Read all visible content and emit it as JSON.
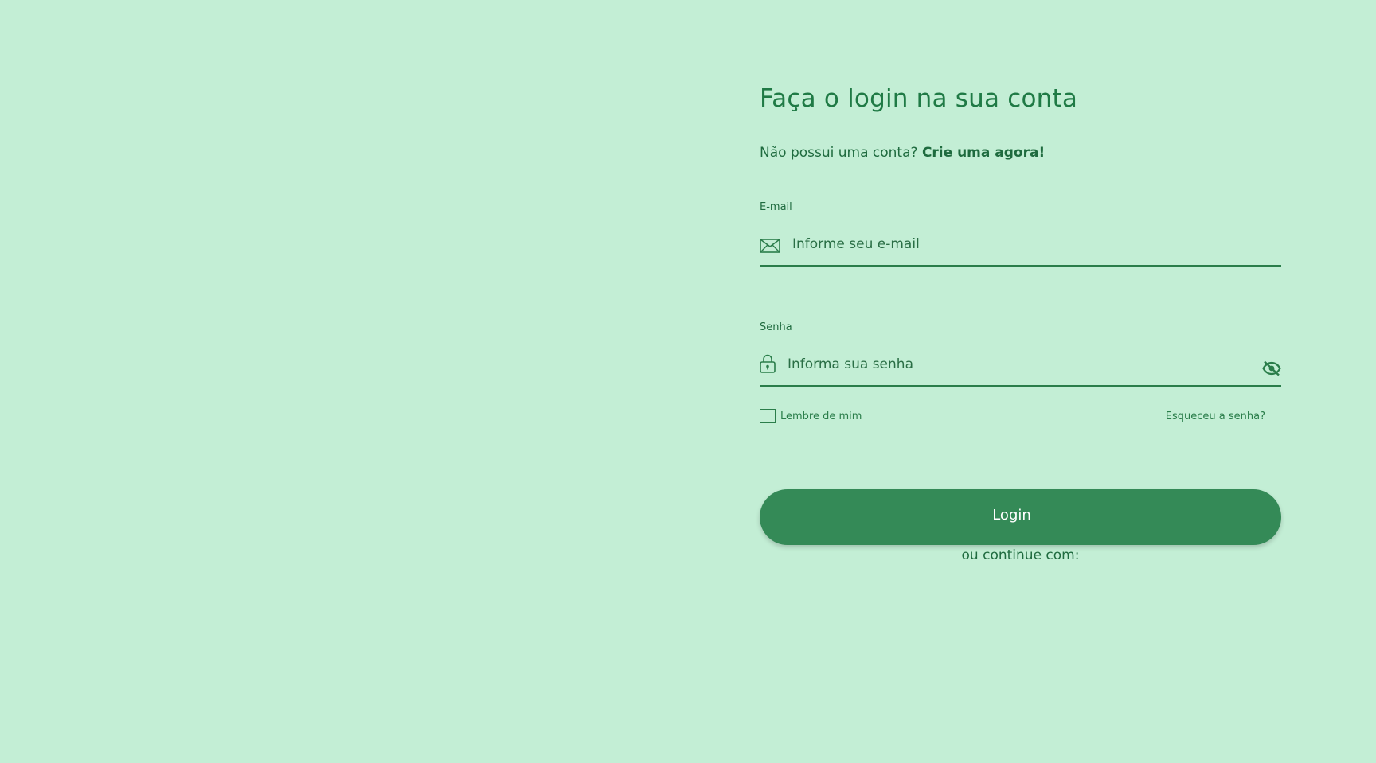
{
  "login": {
    "title": "Faça o login na sua conta",
    "signup_prompt": "Não possui uma conta?",
    "signup_link": "Crie uma agora!",
    "email": {
      "label": "E-mail",
      "placeholder": "Informe seu e-mail",
      "icon": "envelope-icon"
    },
    "password": {
      "label": "Senha",
      "placeholder": "Informa sua senha",
      "icon": "lock-icon",
      "toggle_icon": "eye-off-icon"
    },
    "remember_me": "Lembre de mim",
    "forgot_password": "Esqueceu a senha?",
    "login_button": "Login",
    "continue_with": "ou continue com:"
  },
  "colors": {
    "background": "#c3eed5",
    "primary": "#348a57",
    "text": "#1f6b3f",
    "title": "#1f7a45"
  }
}
